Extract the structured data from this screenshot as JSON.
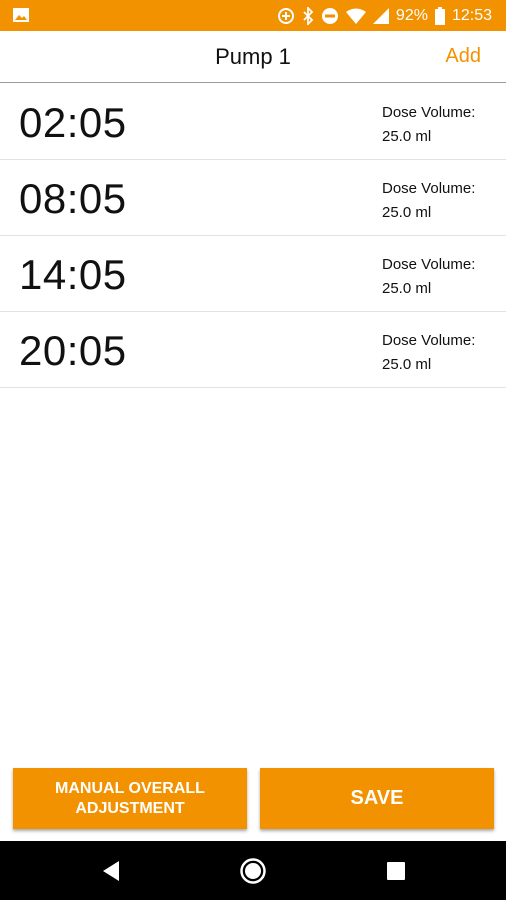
{
  "status_bar": {
    "battery": "92%",
    "time": "12:53",
    "icons": [
      "image-icon",
      "data-saver-icon",
      "bluetooth-icon",
      "do-not-disturb-icon",
      "wifi-icon",
      "signal-icon",
      "battery-icon"
    ],
    "accent_color": "#f39200"
  },
  "app_bar": {
    "title": "Pump 1",
    "add_label": "Add"
  },
  "doses": [
    {
      "time": "02:05",
      "label": "Dose Volume:",
      "volume": "25.0 ml"
    },
    {
      "time": "08:05",
      "label": "Dose Volume:",
      "volume": "25.0 ml"
    },
    {
      "time": "14:05",
      "label": "Dose Volume:",
      "volume": "25.0 ml"
    },
    {
      "time": "20:05",
      "label": "Dose Volume:",
      "volume": "25.0 ml"
    }
  ],
  "buttons": {
    "manual_label": "MANUAL OVERALL ADJUSTMENT",
    "save_label": "SAVE"
  },
  "nav_bar": {
    "icons": [
      "back-icon",
      "home-icon",
      "recents-icon"
    ]
  }
}
